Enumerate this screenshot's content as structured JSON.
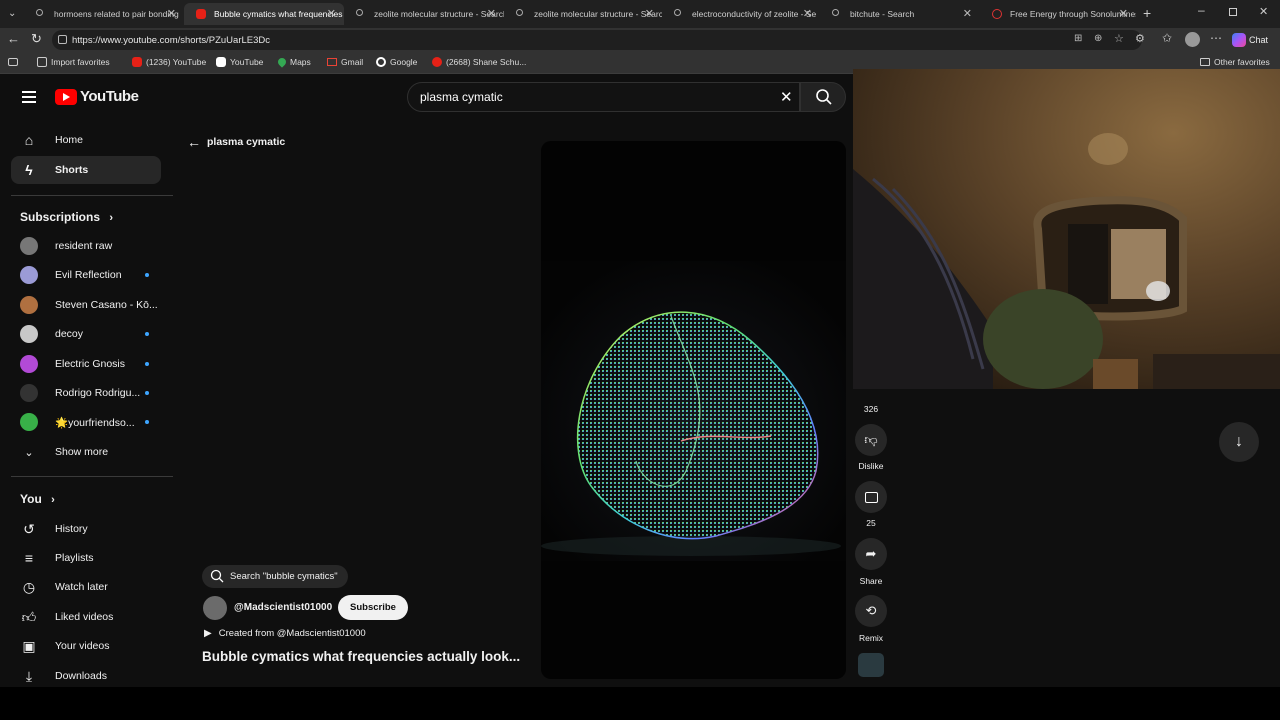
{
  "browser": {
    "tabs": [
      {
        "title": "hormoens related to pair bonding",
        "icon": "search-icon"
      },
      {
        "title": "Bubble cymatics what frequencies",
        "icon": "youtube-icon",
        "active": true
      },
      {
        "title": "zeolite molecular structure - Search",
        "icon": "search-icon"
      },
      {
        "title": "zeolite molecular structure - Search",
        "icon": "search-icon"
      },
      {
        "title": "electroconductivity of zeolite - Se",
        "icon": "search-icon"
      },
      {
        "title": "bitchute - Search",
        "icon": "search-icon"
      },
      {
        "title": "Free Energy through Sonolumines",
        "icon": "red-circle-icon"
      }
    ],
    "url": "https://www.youtube.com/shorts/PZuUarLE3Dc",
    "chat_label": "Chat",
    "bookmarks": [
      {
        "label": "Import favorites"
      },
      {
        "label": "(1236) YouTube"
      },
      {
        "label": "YouTube"
      },
      {
        "label": "Maps"
      },
      {
        "label": "Gmail"
      },
      {
        "label": "Google"
      },
      {
        "label": "(2668) Shane Schu..."
      }
    ],
    "other_favorites": "Other favorites"
  },
  "youtube": {
    "logo_text": "YouTube",
    "search_value": "plasma cymatic",
    "back_label": "plasma cymatic",
    "nav": [
      {
        "label": "Home",
        "icon": "home-icon"
      },
      {
        "label": "Shorts",
        "icon": "shorts-icon",
        "active": true
      }
    ],
    "subscriptions_title": "Subscriptions",
    "subscriptions": [
      {
        "name": "resident raw",
        "dot": false,
        "color": "#777777"
      },
      {
        "name": "Evil Reflection",
        "dot": true,
        "color": "#9b9bd6"
      },
      {
        "name": "Steven Casano - Kō...",
        "dot": false,
        "color": "#b07040"
      },
      {
        "name": "decoy",
        "dot": true,
        "color": "#c8c8c8"
      },
      {
        "name": "Electric Gnosis",
        "dot": true,
        "color": "#b24ad6"
      },
      {
        "name": "Rodrigo Rodrigu...",
        "dot": true,
        "color": "#333333"
      },
      {
        "name": "🌟yourfriendso...",
        "dot": true,
        "color": "#38b048"
      }
    ],
    "show_more": "Show more",
    "you_title": "You",
    "you_items": [
      {
        "label": "History",
        "icon": "history-icon"
      },
      {
        "label": "Playlists",
        "icon": "playlists-icon"
      },
      {
        "label": "Watch later",
        "icon": "watch-later-icon"
      },
      {
        "label": "Liked videos",
        "icon": "thumbs-up-icon"
      },
      {
        "label": "Your videos",
        "icon": "your-videos-icon"
      },
      {
        "label": "Downloads",
        "icon": "download-icon"
      }
    ],
    "short": {
      "search_chip": "Search \"bubble cymatics\"",
      "channel": "@Madscientist01000",
      "subscribe_label": "Subscribe",
      "created_from": "Created from @Madscientist01000",
      "title": "Bubble cymatics what frequencies actually look..."
    },
    "actions": {
      "like_count": "326",
      "dislike_label": "Dislike",
      "comments_count": "25",
      "share_label": "Share",
      "remix_label": "Remix"
    }
  }
}
